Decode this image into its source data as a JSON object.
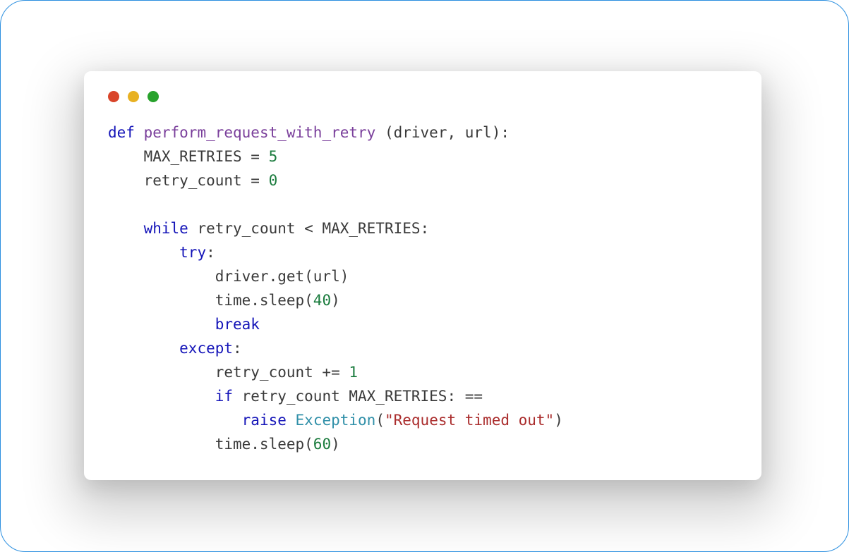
{
  "window": {
    "dots": [
      "close",
      "minimize",
      "zoom"
    ]
  },
  "code": {
    "kw_def": "def",
    "fn_name": "perform_request_with_retry",
    "sig_after_name": " (driver, url):",
    "l2_a": "    MAX_RETRIES = ",
    "l2_num": "5",
    "l3_a": "    retry_count = ",
    "l3_num": "0",
    "l5_a": "    ",
    "kw_while": "while",
    "l5_b": " retry_count < MAX_RETRIES:",
    "l6_a": "        ",
    "kw_try": "try",
    "l6_b": ":",
    "l7": "            driver.get(url)",
    "l8_a": "            time.sleep(",
    "l8_num": "40",
    "l8_b": ")",
    "l9_a": "            ",
    "kw_break": "break",
    "l10_a": "        ",
    "kw_except": "except",
    "l10_b": ":",
    "l11_a": "            retry_count += ",
    "l11_num": "1",
    "l12_a": "            ",
    "kw_if": "if",
    "l12_b": " retry_count MAX_RETRIES: ==",
    "l13_a": "               ",
    "kw_raise": "raise",
    "l13_sp": " ",
    "cls_exception": "Exception",
    "l13_paren_open": "(",
    "str_timeout": "\"Request timed out\"",
    "l13_paren_close": ")",
    "l14_a": "            time.sleep(",
    "l14_num": "60",
    "l14_b": ")"
  }
}
